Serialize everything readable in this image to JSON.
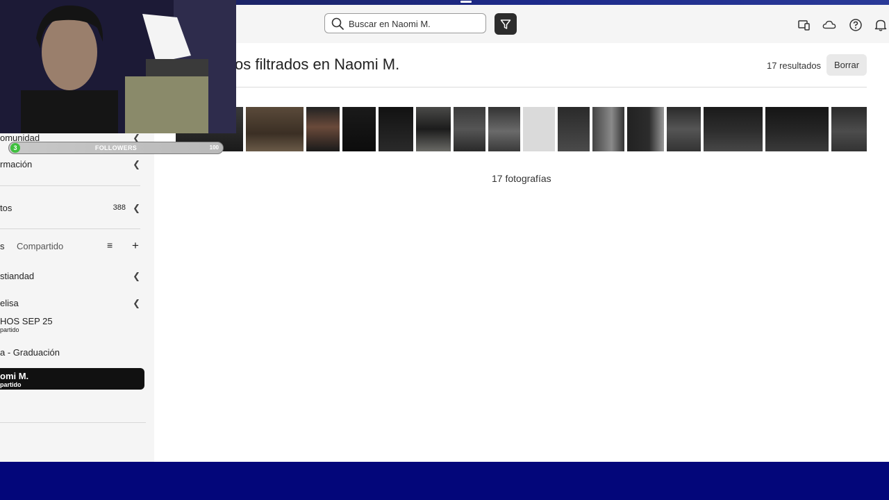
{
  "search": {
    "placeholder": "Buscar en Naomi M."
  },
  "header": {
    "icons": [
      "devices-icon",
      "cloud-icon",
      "help-icon",
      "bell-icon"
    ]
  },
  "main": {
    "title": "os filtrados en Naomi M.",
    "results_label": "17 resultados",
    "clear_label": "Borrar",
    "photo_count": "17 fotografías",
    "photo_thumbnails": 17
  },
  "sidebar": {
    "community": "omunidad",
    "info": "rmación",
    "items_label": "tos",
    "items_count": "388",
    "tab_mine": "s",
    "tab_shared": "Compartido",
    "albums": [
      {
        "name": "stiandad"
      },
      {
        "name": "elisa"
      },
      {
        "name": "HOS SEP 25",
        "sub": "partido"
      },
      {
        "name": "a - Graduación"
      },
      {
        "name": "omi M.",
        "sub": "partido"
      }
    ]
  },
  "overlay": {
    "followers_label": "FOLLOWERS",
    "followers_count": "3",
    "followers_goal": "100"
  },
  "colors": {
    "accent_dark": "#2c2c2c",
    "footer": "#03067a",
    "selected_album": "#111111"
  }
}
